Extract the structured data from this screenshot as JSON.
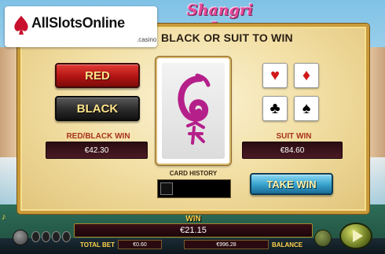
{
  "watermark": {
    "main": "AllSlotsOnline",
    "sub": ".casino"
  },
  "game": {
    "logo": "Shangri La",
    "heading": "BLACK OR SUIT TO WIN"
  },
  "buttons": {
    "red": "RED",
    "black": "BLACK",
    "take_win": "TAKE WIN"
  },
  "red_black": {
    "label": "RED/BLACK WIN",
    "value": "€42.30"
  },
  "suit_win": {
    "label": "SUIT WIN",
    "value": "€84.60"
  },
  "suits": [
    {
      "icon": "heart-icon",
      "glyph": "♥",
      "color": "#d01818"
    },
    {
      "icon": "diamond-icon",
      "glyph": "♦",
      "color": "#d01818"
    },
    {
      "icon": "club-icon",
      "glyph": "♣",
      "color": "#000000"
    },
    {
      "icon": "spade-icon",
      "glyph": "♠",
      "color": "#000000"
    }
  ],
  "card_history": {
    "label": "CARD HISTORY"
  },
  "bottom": {
    "win_label": "WIN",
    "win_value": "€21.15",
    "total_bet_label": "TOTAL BET",
    "total_bet_value": "€0.60",
    "balance_value": "€996.28",
    "balance_label": "BALANCE"
  },
  "colors": {
    "frame_gold": "#c99a3a",
    "red_button": "#b21513",
    "take_win": "#3aa6cf"
  }
}
